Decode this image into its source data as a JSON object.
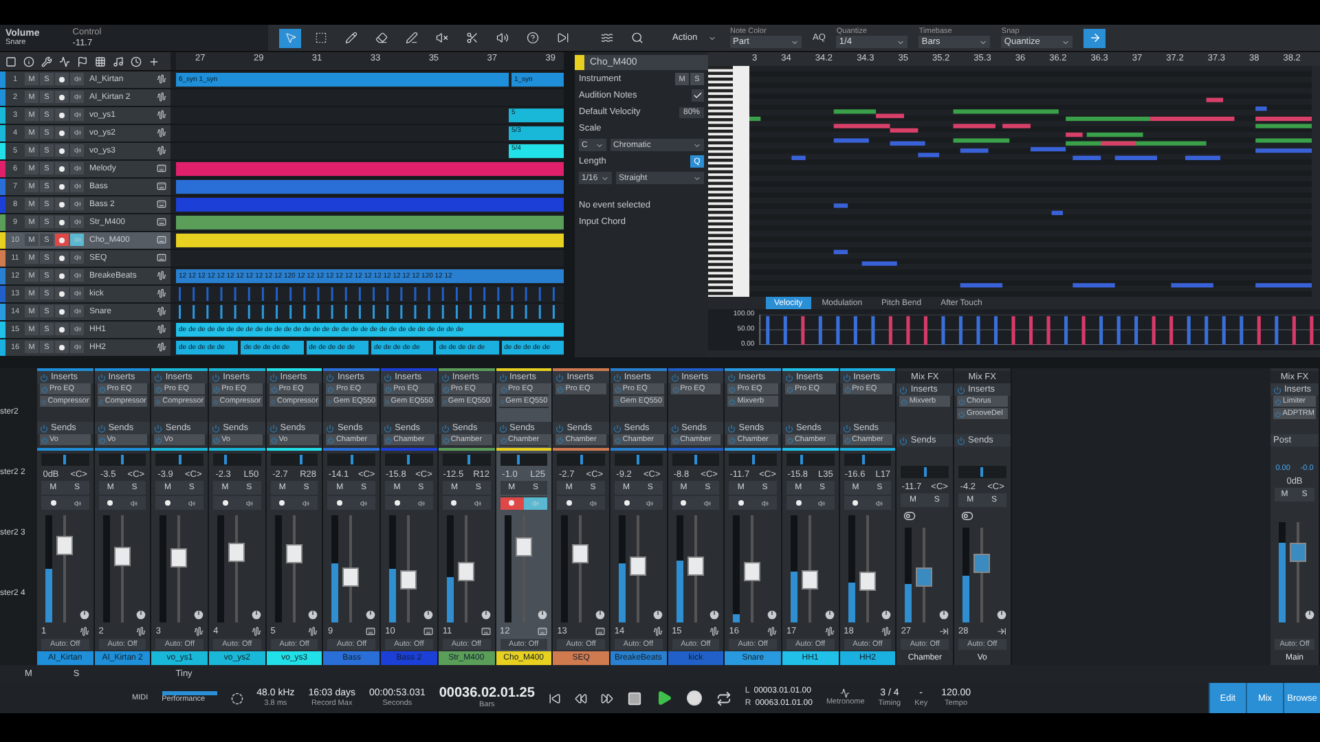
{
  "toolbar": {
    "parameter": "Volume",
    "track": "Snare",
    "mode": "Control",
    "value": "-11.7"
  },
  "track_ruler": [
    "27",
    "29",
    "31",
    "33",
    "35",
    "37",
    "39"
  ],
  "tracks": [
    {
      "number": "1",
      "name": "AI_Kirtan",
      "color": "#1e8fd8",
      "kind": "audio",
      "selected": false,
      "record": false,
      "monitor": false,
      "mute": "M",
      "solo": "S",
      "lane": {
        "kind": "clips",
        "clips": [
          {
            "label": "6_syn 1_syn"
          },
          {
            "label": "1_syn"
          }
        ]
      }
    },
    {
      "number": "2",
      "name": "AI_Kirtan 2",
      "color": "#1e8fd8",
      "kind": "audio",
      "selected": false,
      "record": false,
      "monitor": false,
      "mute": "M",
      "solo": "S",
      "lane": {
        "kind": "empty"
      }
    },
    {
      "number": "3",
      "name": "vo_ys1",
      "color": "#19b8d8",
      "kind": "audio",
      "selected": false,
      "record": false,
      "monitor": false,
      "mute": "M",
      "solo": "S",
      "lane": {
        "kind": "end",
        "clips": [
          {
            "label": "5"
          }
        ]
      }
    },
    {
      "number": "4",
      "name": "vo_ys2",
      "color": "#19b8d8",
      "kind": "audio",
      "selected": false,
      "record": false,
      "monitor": false,
      "mute": "M",
      "solo": "S",
      "lane": {
        "kind": "end",
        "clips": [
          {
            "label": "5/3"
          }
        ]
      }
    },
    {
      "number": "5",
      "name": "vo_ys3",
      "color": "#22e0e8",
      "kind": "audio",
      "selected": false,
      "record": false,
      "monitor": false,
      "mute": "M",
      "solo": "S",
      "lane": {
        "kind": "end",
        "clips": [
          {
            "label": "5/4"
          }
        ]
      }
    },
    {
      "number": "6",
      "name": "Melody",
      "color": "#e0206a",
      "kind": "instrument",
      "selected": false,
      "record": false,
      "monitor": false,
      "mute": "M",
      "solo": "S",
      "lane": {
        "kind": "band"
      }
    },
    {
      "number": "7",
      "name": "Bass",
      "color": "#2a6fd8",
      "kind": "instrument",
      "selected": false,
      "record": false,
      "monitor": false,
      "mute": "M",
      "solo": "S",
      "lane": {
        "kind": "band"
      }
    },
    {
      "number": "8",
      "name": "Bass 2",
      "color": "#1c3fd8",
      "kind": "instrument",
      "selected": false,
      "record": false,
      "monitor": false,
      "mute": "M",
      "solo": "S",
      "lane": {
        "kind": "band"
      }
    },
    {
      "number": "9",
      "name": "Str_M400",
      "color": "#5a9e5a",
      "kind": "instrument",
      "selected": false,
      "record": false,
      "monitor": false,
      "mute": "M",
      "solo": "S",
      "lane": {
        "kind": "band"
      }
    },
    {
      "number": "10",
      "name": "Cho_M400",
      "color": "#e8d020",
      "kind": "instrument",
      "selected": true,
      "record": true,
      "monitor": true,
      "mute": "M",
      "solo": "S",
      "lane": {
        "kind": "band"
      }
    },
    {
      "number": "11",
      "name": "SEQ",
      "color": "#d07a50",
      "kind": "instrument",
      "selected": false,
      "record": false,
      "monitor": false,
      "mute": "M",
      "solo": "S",
      "lane": {
        "kind": "empty"
      }
    },
    {
      "number": "12",
      "name": "BreakeBeats",
      "color": "#2a80d0",
      "kind": "audio",
      "selected": false,
      "record": false,
      "monitor": false,
      "mute": "M",
      "solo": "S",
      "lane": {
        "kind": "text",
        "clips": [
          {
            "label": "12 12 12 12 12 12 12 12 12 12 12 120 12 12 12 12 12 12 12 12 12 12 12 12 12 120 12 12"
          }
        ]
      }
    },
    {
      "number": "13",
      "name": "kick",
      "color": "#2060c8",
      "kind": "audio",
      "selected": false,
      "record": false,
      "monitor": false,
      "mute": "M",
      "solo": "S",
      "lane": {
        "kind": "hits"
      }
    },
    {
      "number": "14",
      "name": "Snare",
      "color": "#2a9ae0",
      "kind": "audio",
      "selected": false,
      "record": false,
      "monitor": false,
      "mute": "M",
      "solo": "S",
      "lane": {
        "kind": "hits"
      }
    },
    {
      "number": "15",
      "name": "HH1",
      "color": "#20c0e8",
      "kind": "audio",
      "selected": false,
      "record": false,
      "monitor": false,
      "mute": "M",
      "solo": "S",
      "lane": {
        "kind": "text",
        "clips": [
          {
            "label": "de de de de de de de de de de de de de de de de de de de de de de de de de de de de de de"
          }
        ]
      }
    },
    {
      "number": "16",
      "name": "HH2",
      "color": "#1ab0e0",
      "kind": "audio",
      "selected": false,
      "record": false,
      "monitor": false,
      "mute": "M",
      "solo": "S",
      "lane": {
        "kind": "segments",
        "clips": [
          {
            "label": "de de de de de"
          },
          {
            "label": "de de de de de"
          },
          {
            "label": "de de de de de"
          },
          {
            "label": "de de de de de"
          },
          {
            "label": "de de de de de"
          },
          {
            "label": "de de de de de"
          }
        ]
      }
    }
  ],
  "inspector": {
    "track": "Cho_M400",
    "color": "#e8d020",
    "instrument": "Instrument",
    "mute": "M",
    "solo": "S",
    "audition": {
      "label": "Audition Notes",
      "checked": true
    },
    "velocity": {
      "label": "Default Velocity",
      "value": "80%"
    },
    "scale": "Scale",
    "key": "C",
    "scale_type": "Chromatic",
    "length": {
      "label": "Length",
      "button": "Q"
    },
    "grid": "1/16",
    "feel": "Straight",
    "status": "No event selected",
    "input_chord": "Input Chord"
  },
  "editor_toolbar": {
    "action": "Action",
    "note_color": {
      "label": "Note Color",
      "value": "Part"
    },
    "aq": "AQ",
    "quantize": {
      "label": "Quantize",
      "value": "1/4"
    },
    "timebase": {
      "label": "Timebase",
      "value": "Bars"
    },
    "snap": {
      "label": "Snap",
      "value": "Quantize"
    }
  },
  "editor_ruler": [
    "3",
    "34",
    "34.2",
    "34.3",
    "35",
    "35.2",
    "35.3",
    "36",
    "36.2",
    "36.3",
    "37",
    "37.2",
    "37.3",
    "38",
    "38.2"
  ],
  "editor_tabs": [
    {
      "label": "Velocity",
      "selected": true
    },
    {
      "label": "Modulation",
      "selected": false
    },
    {
      "label": "Pitch Bend",
      "selected": false
    },
    {
      "label": "After Touch",
      "selected": false
    }
  ],
  "velocity_lane": {
    "chart_data": {
      "type": "bar",
      "categories": [
        null,
        null,
        null,
        null,
        null,
        null,
        null,
        null,
        null,
        null,
        null,
        null,
        null,
        null,
        null,
        null,
        null,
        null,
        null,
        null,
        null,
        null,
        null,
        null,
        null,
        null,
        null,
        null,
        null,
        null,
        null,
        null
      ],
      "ylim": [
        0,
        100
      ],
      "yticks": [
        {
          "value": 0,
          "label": "0.00"
        },
        {
          "value": 50,
          "label": "50.00"
        },
        {
          "value": 100,
          "label": "100.00"
        }
      ],
      "series": [
        {
          "color": "#3a6fd8",
          "values": [
            95,
            95,
            null,
            95,
            95,
            95,
            95,
            null,
            null,
            null,
            95,
            95,
            95,
            95,
            null,
            null,
            null,
            95,
            null,
            95,
            95,
            95,
            null,
            null,
            95,
            95,
            95,
            95,
            null,
            95,
            null,
            null
          ]
        },
        {
          "color": "#d83a6a",
          "values": [
            null,
            null,
            95,
            null,
            null,
            null,
            null,
            95,
            95,
            95,
            null,
            null,
            null,
            null,
            95,
            95,
            95,
            null,
            95,
            null,
            null,
            null,
            95,
            95,
            null,
            null,
            null,
            null,
            95,
            null,
            95,
            95
          ]
        }
      ]
    }
  },
  "mixer_side": [
    "ster2",
    "ster2 2",
    "ster2 3",
    "ster2 4"
  ],
  "channels": [
    {
      "kind": "audio",
      "number": "1",
      "name": "AI_Kirtan",
      "color": "#1e8fd8",
      "inserts_label": "Inserts",
      "inserts": [
        "Pro EQ",
        "Compressor"
      ],
      "sends_label": "Sends",
      "sends": [
        "Vo"
      ],
      "volume": "0dB",
      "pan": {
        "reading": "<C>",
        "level": 0.5
      },
      "mute": "M",
      "solo": "S",
      "record": false,
      "monitor": false,
      "selected": false,
      "fader": {
        "level": 0.72
      },
      "meter": {
        "level": 0.5
      },
      "automation": "Auto: Off"
    },
    {
      "kind": "audio",
      "number": "2",
      "name": "AI_Kirtan 2",
      "color": "#1e8fd8",
      "inserts_label": "Inserts",
      "inserts": [
        "Pro EQ",
        "Compressor"
      ],
      "sends_label": "Sends",
      "sends": [
        "Vo"
      ],
      "volume": "-3.5",
      "pan": {
        "reading": "<C>",
        "level": 0.5
      },
      "mute": "M",
      "solo": "S",
      "record": false,
      "monitor": false,
      "selected": false,
      "fader": {
        "level": 0.62
      },
      "automation": "Auto: Off"
    },
    {
      "kind": "audio",
      "number": "3",
      "name": "vo_ys1",
      "color": "#19b8d8",
      "inserts_label": "Inserts",
      "inserts": [
        "Pro EQ",
        "Compressor"
      ],
      "sends_label": "Sends",
      "sends": [
        "Vo"
      ],
      "volume": "-3.9",
      "pan": {
        "reading": "<C>",
        "level": 0.5
      },
      "mute": "M",
      "solo": "S",
      "record": false,
      "monitor": false,
      "selected": false,
      "fader": {
        "level": 0.6
      },
      "automation": "Auto: Off"
    },
    {
      "kind": "audio",
      "number": "4",
      "name": "vo_ys2",
      "color": "#19b8d8",
      "inserts_label": "Inserts",
      "inserts": [
        "Pro EQ",
        "Compressor"
      ],
      "sends_label": "Sends",
      "sends": [
        "Vo"
      ],
      "volume": "-2.3",
      "pan": {
        "reading": "L50",
        "level": 0.25
      },
      "mute": "M",
      "solo": "S",
      "record": false,
      "monitor": false,
      "selected": false,
      "fader": {
        "level": 0.66
      },
      "automation": "Auto: Off"
    },
    {
      "kind": "audio",
      "number": "5",
      "name": "vo_ys3",
      "color": "#22e0e8",
      "inserts_label": "Inserts",
      "inserts": [
        "Pro EQ",
        "Compressor"
      ],
      "sends_label": "Sends",
      "sends": [
        "Vo"
      ],
      "volume": "-2.7",
      "pan": {
        "reading": "R28",
        "level": 0.64
      },
      "mute": "M",
      "solo": "S",
      "record": false,
      "monitor": false,
      "selected": false,
      "fader": {
        "level": 0.64
      },
      "automation": "Auto: Off"
    },
    {
      "kind": "instrument",
      "number": "9",
      "name": "Bass",
      "color": "#2a6fd8",
      "inserts_label": "Inserts",
      "inserts": [
        "Pro EQ",
        "Gem EQ550"
      ],
      "sends_label": "Sends",
      "sends": [
        "Chamber"
      ],
      "volume": "-14.1",
      "pan": {
        "reading": "<C>",
        "level": 0.5
      },
      "mute": "M",
      "solo": "S",
      "record": false,
      "monitor": false,
      "selected": false,
      "fader": {
        "level": 0.42
      },
      "meter": {
        "level": 0.55
      },
      "automation": "Auto: Off"
    },
    {
      "kind": "instrument",
      "number": "10",
      "name": "Bass 2",
      "color": "#1c3fd8",
      "inserts_label": "Inserts",
      "inserts": [
        "Pro EQ",
        "Gem EQ550"
      ],
      "sends_label": "Sends",
      "sends": [
        "Chamber"
      ],
      "volume": "-15.8",
      "pan": {
        "reading": "<C>",
        "level": 0.5
      },
      "mute": "M",
      "solo": "S",
      "record": false,
      "monitor": false,
      "selected": false,
      "fader": {
        "level": 0.4
      },
      "meter": {
        "level": 0.5
      },
      "automation": "Auto: Off"
    },
    {
      "kind": "instrument",
      "number": "11",
      "name": "Str_M400",
      "color": "#5a9e5a",
      "inserts_label": "Inserts",
      "inserts": [
        "Pro EQ",
        "Gem EQ550"
      ],
      "sends_label": "Sends",
      "sends": [
        "Chamber"
      ],
      "volume": "-12.5",
      "pan": {
        "reading": "R12",
        "level": 0.56
      },
      "mute": "M",
      "solo": "S",
      "record": false,
      "monitor": false,
      "selected": false,
      "fader": {
        "level": 0.47
      },
      "meter": {
        "level": 0.42
      },
      "automation": "Auto: Off"
    },
    {
      "kind": "instrument",
      "number": "12",
      "name": "Cho_M400",
      "color": "#e8d020",
      "inserts_label": "Inserts",
      "inserts": [
        "Pro EQ",
        "Gem EQ550"
      ],
      "sends_label": "Sends",
      "sends": [
        "Chamber"
      ],
      "volume": "-1.0",
      "pan": {
        "reading": "L25",
        "level": 0.375
      },
      "mute": "M",
      "solo": "S",
      "record": true,
      "monitor": true,
      "selected": true,
      "fader": {
        "level": 0.7
      },
      "automation": "Auto: Off"
    },
    {
      "kind": "instrument",
      "number": "13",
      "name": "SEQ",
      "color": "#d07a50",
      "inserts_label": "Inserts",
      "inserts": [
        "Pro EQ"
      ],
      "sends_label": "Sends",
      "sends": [
        "Chamber"
      ],
      "volume": "-2.7",
      "pan": {
        "reading": "<C>",
        "level": 0.5
      },
      "mute": "M",
      "solo": "S",
      "record": false,
      "monitor": false,
      "selected": false,
      "fader": {
        "level": 0.64
      },
      "automation": "Auto: Off"
    },
    {
      "kind": "audio",
      "number": "14",
      "name": "BreakeBeats",
      "color": "#2a80d0",
      "inserts_label": "Inserts",
      "inserts": [
        "Pro EQ",
        "Gem EQ550"
      ],
      "sends_label": "Sends",
      "sends": [
        "Chamber"
      ],
      "volume": "-9.2",
      "pan": {
        "reading": "<C>",
        "level": 0.5
      },
      "mute": "M",
      "solo": "S",
      "record": false,
      "monitor": false,
      "selected": false,
      "fader": {
        "level": 0.52
      },
      "meter": {
        "level": 0.55
      },
      "automation": "Auto: Off"
    },
    {
      "kind": "audio",
      "number": "15",
      "name": "kick",
      "color": "#2060c8",
      "inserts_label": "Inserts",
      "inserts": [
        "Pro EQ"
      ],
      "sends_label": "Sends",
      "sends": [
        "Chamber"
      ],
      "volume": "-8.8",
      "pan": {
        "reading": "<C>",
        "level": 0.5
      },
      "mute": "M",
      "solo": "S",
      "record": false,
      "monitor": false,
      "selected": false,
      "fader": {
        "level": 0.53
      },
      "meter": {
        "level": 0.58
      },
      "automation": "Auto: Off"
    },
    {
      "kind": "audio",
      "number": "16",
      "name": "Snare",
      "color": "#2a9ae0",
      "inserts_label": "Inserts",
      "inserts": [
        "Pro EQ",
        "Mixverb"
      ],
      "sends_label": "Sends",
      "sends": [
        "Chamber"
      ],
      "volume": "-11.7",
      "pan": {
        "reading": "<C>",
        "level": 0.5
      },
      "mute": "M",
      "solo": "S",
      "record": false,
      "monitor": false,
      "selected": false,
      "fader": {
        "level": 0.48
      },
      "meter": {
        "level": 0.08
      },
      "automation": "Auto: Off"
    },
    {
      "kind": "audio",
      "number": "17",
      "name": "HH1",
      "color": "#20c0e8",
      "inserts_label": "Inserts",
      "inserts": [
        "Pro EQ"
      ],
      "sends_label": "Sends",
      "sends": [
        "Chamber"
      ],
      "volume": "-15.8",
      "pan": {
        "reading": "L35",
        "level": 0.325
      },
      "mute": "M",
      "solo": "S",
      "record": false,
      "monitor": false,
      "selected": false,
      "fader": {
        "level": 0.4
      },
      "meter": {
        "level": 0.47
      },
      "automation": "Auto: Off"
    },
    {
      "kind": "audio",
      "number": "18",
      "name": "HH2",
      "color": "#1ab0e0",
      "inserts_label": "Inserts",
      "inserts": [
        "Pro EQ"
      ],
      "sends_label": "Sends",
      "sends": [
        "Chamber"
      ],
      "volume": "-16.6",
      "pan": {
        "reading": "L17",
        "level": 0.415
      },
      "mute": "M",
      "solo": "S",
      "record": false,
      "monitor": false,
      "selected": false,
      "fader": {
        "level": 0.38
      },
      "meter": {
        "level": 0.37
      },
      "automation": "Auto: Off"
    },
    {
      "kind": "fx",
      "header": "Mix FX",
      "number": "27",
      "name": "Chamber",
      "inserts_label": "Inserts",
      "inserts": [
        "Mixverb"
      ],
      "sends_label": "Sends",
      "volume": "-11.7",
      "pan": {
        "reading": "<C>",
        "level": 0.5
      },
      "mute": "M",
      "solo": "S",
      "selected": false,
      "fader": {
        "level": 0.48
      },
      "meter": {
        "level": 0.4
      },
      "automation": "Auto: Off"
    },
    {
      "kind": "fx",
      "header": "Mix FX",
      "number": "28",
      "name": "Vo",
      "inserts_label": "Inserts",
      "inserts": [
        "Chorus",
        "GrooveDel"
      ],
      "sends_label": "Sends",
      "volume": "-4.2",
      "pan": {
        "reading": "<C>",
        "level": 0.5
      },
      "mute": "M",
      "solo": "S",
      "selected": false,
      "fader": {
        "level": 0.62
      },
      "meter": {
        "level": 0.5
      },
      "automation": "Auto: Off"
    }
  ],
  "main": {
    "kind": "main",
    "header": "Mix FX",
    "name": "Main",
    "inserts_label": "Inserts",
    "inserts": [
      "Limiter",
      "ADPTRM"
    ],
    "post": "Post",
    "peaks": [
      "0.00",
      "-0.0"
    ],
    "volume": "0dB",
    "mute": "M",
    "solo": "S",
    "fader": {
      "level": 0.7
    },
    "meter": {
      "level": 0.8
    },
    "automation": "Auto: Off"
  },
  "mixer_footer": {
    "mute": "M",
    "solo": "S",
    "zoom": "Tiny"
  },
  "transport": {
    "midi": "MIDI",
    "performance": "Performance",
    "sample_rate": "48.0 kHz",
    "latency": "3.8 ms",
    "record_max": {
      "value": "16:03 days",
      "label": "Record Max"
    },
    "seconds": {
      "value": "00:00:53.031",
      "label": "Seconds"
    },
    "bars": {
      "value": "00036.02.01.25",
      "label": "Bars"
    },
    "loop_left": {
      "tag": "L",
      "value": "00003.01.01.00"
    },
    "loop_right": {
      "tag": "R",
      "value": "00063.01.01.00"
    },
    "metronome": "Metronome",
    "timing": {
      "value": "3 / 4",
      "label": "Timing"
    },
    "key": {
      "value": "-",
      "label": "Key"
    },
    "tempo": {
      "value": "120.00",
      "label": "Tempo"
    },
    "views": [
      {
        "label": "Edit",
        "selected": true
      },
      {
        "label": "Mix",
        "selected": true
      },
      {
        "label": "Browse",
        "selected": true
      }
    ]
  }
}
